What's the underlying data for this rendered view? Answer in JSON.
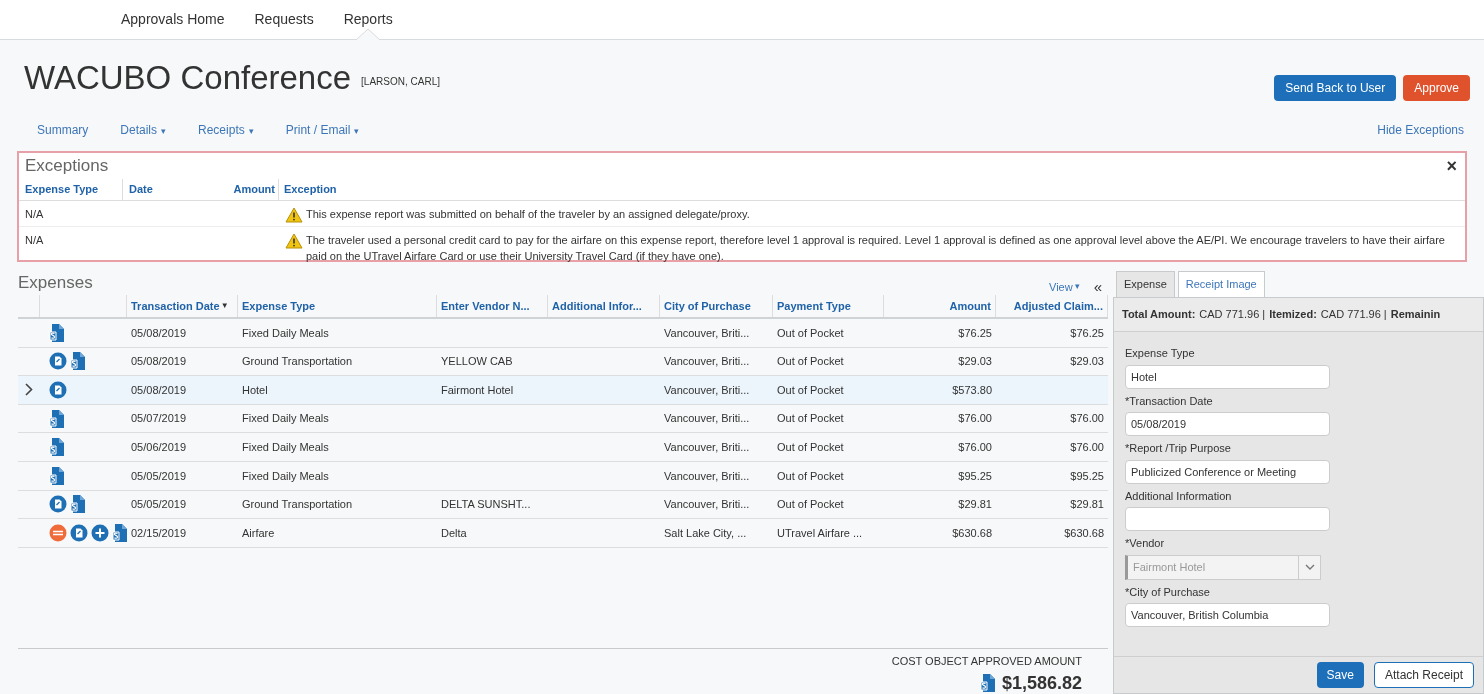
{
  "top_nav": [
    {
      "label": "Approvals Home",
      "selected": false
    },
    {
      "label": "Requests",
      "selected": false
    },
    {
      "label": "Reports",
      "selected": true
    }
  ],
  "report": {
    "title": "WACUBO Conference",
    "employee": "[LARSON, CARL]"
  },
  "actions": [
    "Send Back to User",
    "Approve"
  ],
  "sub_nav": [
    {
      "label": "Summary"
    },
    {
      "label": "Details",
      "caret": "▾"
    },
    {
      "label": "Receipts",
      "caret": "▾"
    },
    {
      "label": "Print / Email",
      "caret": "▾"
    }
  ],
  "hide_exceptions": "Hide Exceptions",
  "exceptions": {
    "title": "Exceptions",
    "close": "×",
    "columns": [
      "Expense Type",
      "Date",
      "Amount",
      "Exception"
    ],
    "rows": [
      {
        "expense_type": "N/A",
        "exception": "This expense report was submitted on behalf of the traveler by an assigned delegate/proxy."
      },
      {
        "expense_type": "N/A",
        "exception": "The traveler used a personal credit card to pay for the airfare on this expense report, therefore level 1 approval is required. Level 1 approval is defined as one approval level above the AE/PI. We encourage travelers to have their airfare paid on the UTravel Airfare Card or use their University Travel Card (if they have one)."
      }
    ]
  },
  "expenses": {
    "title": "Expenses",
    "view": "View",
    "view_caret": "▾",
    "collapse": "«",
    "sort_indicator": "▼",
    "columns": [
      "Transaction Date",
      "Expense Type",
      "Enter Vendor N...",
      "Additional Infor...",
      "City of Purchase",
      "Payment Type",
      "Amount",
      "Adjusted Claim..."
    ],
    "rows": [
      {
        "selected": false,
        "icons": [
          {
            "kind": "receipt"
          }
        ],
        "cells": [
          "05/08/2019",
          "Fixed Daily Meals",
          "",
          "",
          "Vancouver, Briti...",
          "Out of Pocket",
          "$76.25",
          "$76.25"
        ]
      },
      {
        "selected": false,
        "icons": [
          {
            "kind": "comment"
          },
          {
            "kind": "receipt"
          }
        ],
        "cells": [
          "05/08/2019",
          "Ground Transportation",
          "YELLOW CAB",
          "",
          "Vancouver, Briti...",
          "Out of Pocket",
          "$29.03",
          "$29.03"
        ]
      },
      {
        "selected": true,
        "icons": [
          {
            "kind": "comment"
          }
        ],
        "cells": [
          "05/08/2019",
          "Hotel",
          "Fairmont Hotel",
          "",
          "Vancouver, Briti...",
          "Out of Pocket",
          "$573.80",
          ""
        ]
      },
      {
        "selected": false,
        "icons": [
          {
            "kind": "receipt"
          }
        ],
        "cells": [
          "05/07/2019",
          "Fixed Daily Meals",
          "",
          "",
          "Vancouver, Briti...",
          "Out of Pocket",
          "$76.00",
          "$76.00"
        ]
      },
      {
        "selected": false,
        "icons": [
          {
            "kind": "receipt"
          }
        ],
        "cells": [
          "05/06/2019",
          "Fixed Daily Meals",
          "",
          "",
          "Vancouver, Briti...",
          "Out of Pocket",
          "$76.00",
          "$76.00"
        ]
      },
      {
        "selected": false,
        "icons": [
          {
            "kind": "receipt"
          }
        ],
        "cells": [
          "05/05/2019",
          "Fixed Daily Meals",
          "",
          "",
          "Vancouver, Briti...",
          "Out of Pocket",
          "$95.25",
          "$95.25"
        ]
      },
      {
        "selected": false,
        "icons": [
          {
            "kind": "comment"
          },
          {
            "kind": "receipt"
          }
        ],
        "cells": [
          "05/05/2019",
          "Ground Transportation",
          "DELTA SUNSHT...",
          "",
          "Vancouver, Briti...",
          "Out of Pocket",
          "$29.81",
          "$29.81"
        ]
      },
      {
        "selected": false,
        "icons": [
          {
            "kind": "exception"
          },
          {
            "kind": "comment"
          },
          {
            "kind": "add"
          },
          {
            "kind": "receipt"
          }
        ],
        "cells": [
          "02/15/2019",
          "Airfare",
          "Delta",
          "",
          "Salt Lake City, ...",
          "UTravel Airfare ...",
          "$630.68",
          "$630.68"
        ]
      }
    ],
    "total_label": "COST OBJECT APPROVED AMOUNT",
    "total": "$1,586.82"
  },
  "detail_panel": {
    "tabs": [
      {
        "label": "Expense",
        "selected": true
      },
      {
        "label": "Receipt Image",
        "selected": false
      }
    ],
    "summary": [
      {
        "label": "Total Amount:",
        "value": "CAD 771.96 |"
      },
      {
        "label": "Itemized:",
        "value": "CAD 771.96 |"
      },
      {
        "label": "Remainin"
      }
    ],
    "fields": [
      {
        "kind": "text",
        "label": "Expense Type",
        "value": "Hotel"
      },
      {
        "kind": "text",
        "label": "*Transaction Date",
        "value": "05/08/2019"
      },
      {
        "kind": "text",
        "label": "*Report /Trip Purpose",
        "value": "Publicized Conference or Meeting"
      },
      {
        "kind": "text",
        "label": "Additional Information"
      },
      {
        "kind": "select",
        "label": "*Vendor",
        "value": "Fairmont Hotel",
        "disabled": true
      },
      {
        "kind": "text",
        "label": "*City of Purchase",
        "value": "Vancouver, British Columbia"
      }
    ],
    "buttons": [
      "Save",
      "Attach Receipt"
    ]
  }
}
